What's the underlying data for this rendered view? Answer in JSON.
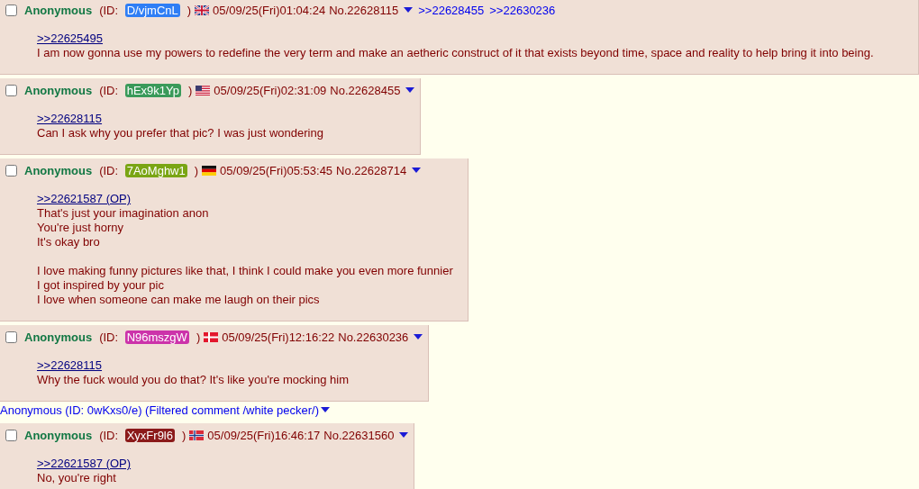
{
  "posts": [
    {
      "kind": "post",
      "name": "Anonymous",
      "id_label": "(ID: ",
      "id": "D/vjmCnL",
      "color": "#2f7ef5",
      "id_close": ")",
      "checked": false,
      "flag": {
        "kind": "uk"
      },
      "datetime": "05/09/25(Fri)01:04:24",
      "number": "No.22628115",
      "backlinks": [
        ">>22628455",
        ">>22630236"
      ],
      "wide": true,
      "quote": ">>22625495",
      "paragraphs": [
        [
          "I am now gonna use my powers to redefine the very term and make an aetheric construct of it that exists beyond time, space and reality to help bring it into being."
        ]
      ]
    },
    {
      "kind": "post",
      "name": "Anonymous",
      "id_label": "(ID: ",
      "id": "hEx9k1Yp",
      "color": "#3a9a5a",
      "id_close": ")",
      "checked": false,
      "flag": {
        "kind": "us"
      },
      "datetime": "05/09/25(Fri)02:31:09",
      "number": "No.22628455",
      "wide": false,
      "quote": ">>22628115",
      "paragraphs": [
        [
          "Can I ask why you prefer that pic? I was just wondering"
        ]
      ]
    },
    {
      "kind": "post",
      "name": "Anonymous",
      "id_label": "(ID: ",
      "id": "7AoMghw1",
      "color": "#7aa514",
      "id_close": ")",
      "checked": false,
      "flag": {
        "kind": "de"
      },
      "datetime": "05/09/25(Fri)05:53:45",
      "number": "No.22628714",
      "wide": false,
      "quote": ">>22621587 (OP)",
      "paragraphs": [
        [
          "That's just your imagination anon",
          "You're just horny",
          "It's okay bro"
        ],
        [
          "I love making funny pictures like that, I think I could make you even more funnier",
          "I got inspired by your pic",
          "I love when someone can make me laugh on their pics"
        ]
      ]
    },
    {
      "kind": "post",
      "name": "Anonymous",
      "id_label": "(ID: ",
      "id": "N96mszgW",
      "color": "#cc33aa",
      "id_close": ")",
      "checked": false,
      "flag": {
        "kind": "dk"
      },
      "datetime": "05/09/25(Fri)12:16:22",
      "number": "No.22630236",
      "wide": false,
      "quote": ">>22628115",
      "paragraphs": [
        [
          "Why the fuck would you do that? It's like you're mocking him"
        ]
      ]
    },
    {
      "kind": "filtered",
      "text": "Anonymous (ID: 0wKxs0/e) (Filtered comment /white pecker/)"
    },
    {
      "kind": "post",
      "name": "Anonymous",
      "id_label": "(ID: ",
      "id": "XyxFr9l6",
      "color": "#8b1a1a",
      "id_close": ")",
      "checked": false,
      "flag": {
        "kind": "no"
      },
      "datetime": "05/09/25(Fri)16:46:17",
      "number": "No.22631560",
      "wide": false,
      "quote": ">>22621587 (OP)",
      "paragraphs": [
        [
          "No, you're right"
        ]
      ]
    }
  ]
}
